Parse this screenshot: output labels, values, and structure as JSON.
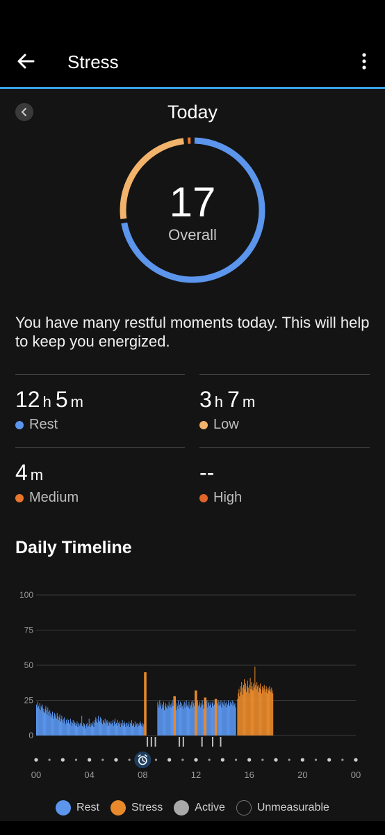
{
  "header": {
    "title": "Stress"
  },
  "overview": {
    "date_label": "Today",
    "score": "17",
    "score_label": "Overall",
    "ring": {
      "rest_fraction": 0.725,
      "low_fraction": 0.259,
      "medium_fraction": 0.016,
      "colors": {
        "rest": "#5b95ec",
        "low": "#f2b36b",
        "medium": "#e8762c"
      }
    }
  },
  "summary_text": "You have many restful moments today. This will help to keep you energized.",
  "stats": [
    {
      "h": "12",
      "h_unit": "h",
      "m": "5",
      "m_unit": "m",
      "label": "Rest",
      "color": "#5b95ec"
    },
    {
      "h": "3",
      "h_unit": "h",
      "m": "7",
      "m_unit": "m",
      "label": "Low",
      "color": "#f2b36b"
    },
    {
      "h": "",
      "h_unit": "",
      "m": "4",
      "m_unit": "m",
      "label": "Medium",
      "color": "#e8762c"
    },
    {
      "h": "",
      "h_unit": "",
      "m": "--",
      "m_unit": "",
      "label": "High",
      "color": "#e0652a"
    }
  ],
  "timeline": {
    "title": "Daily Timeline"
  },
  "chart_data": {
    "type": "bar",
    "title": "Daily Timeline",
    "x_ticks": [
      "00",
      "04",
      "08",
      "12",
      "16",
      "20",
      "00"
    ],
    "y_ticks": [
      0,
      25,
      50,
      75,
      100
    ],
    "ylim": [
      0,
      100
    ],
    "xlim_hours": [
      0,
      24
    ],
    "grid": true,
    "legend_placement": "bottom",
    "series": [
      {
        "name": "Rest",
        "color": "#5b95ec",
        "segments": [
          {
            "start_hour": 0.0,
            "end_hour": 0.6,
            "values": [
              22,
              20,
              24,
              21,
              19,
              23,
              18,
              21,
              20,
              22,
              19,
              17
            ]
          },
          {
            "start_hour": 0.6,
            "end_hour": 1.4,
            "values": [
              16,
              19,
              21,
              18,
              15,
              20,
              17,
              14,
              18,
              16,
              13,
              15,
              17,
              12,
              14,
              16
            ]
          },
          {
            "start_hour": 1.4,
            "end_hour": 2.4,
            "values": [
              15,
              13,
              12,
              16,
              14,
              11,
              13,
              15,
              10,
              12,
              14,
              11,
              9,
              12,
              13,
              10,
              8,
              11,
              12,
              9
            ]
          },
          {
            "start_hour": 2.4,
            "end_hour": 3.3,
            "values": [
              11,
              9,
              8,
              12,
              10,
              7,
              9,
              11,
              8,
              10,
              9,
              7,
              8,
              10,
              6,
              9,
              8,
              7
            ]
          },
          {
            "start_hour": 3.3,
            "end_hour": 4.4,
            "values": [
              9,
              8,
              14,
              7,
              6,
              9,
              8,
              7,
              5,
              8,
              9,
              6,
              7,
              12,
              8,
              6,
              9,
              7,
              8,
              10,
              6,
              9
            ]
          },
          {
            "start_hour": 4.4,
            "end_hour": 5.6,
            "values": [
              11,
              13,
              10,
              12,
              9,
              14,
              11,
              10,
              13,
              9,
              12,
              8,
              11,
              10,
              9,
              12,
              8,
              10,
              11,
              9,
              7,
              10,
              9,
              8
            ]
          },
          {
            "start_hour": 5.6,
            "end_hour": 6.8,
            "values": [
              10,
              8,
              9,
              11,
              7,
              10,
              12,
              8,
              9,
              7,
              11,
              9,
              8,
              10,
              6,
              9,
              8,
              11,
              7,
              9,
              10,
              8,
              6,
              9
            ]
          },
          {
            "start_hour": 6.8,
            "end_hour": 8.1,
            "values": [
              9,
              7,
              8,
              10,
              6,
              9,
              8,
              11,
              7,
              9,
              8,
              6,
              10,
              7,
              8,
              9,
              6,
              8,
              7,
              9,
              10,
              8,
              7,
              9,
              6,
              8
            ]
          },
          {
            "start_hour": 9.1,
            "end_hour": 10.1,
            "values": [
              24,
              22,
              20,
              25,
              21,
              23,
              19,
              22,
              20,
              24,
              18,
              21,
              23,
              20,
              22,
              19,
              21,
              24,
              20,
              22
            ]
          },
          {
            "start_hour": 10.1,
            "end_hour": 11.6,
            "values": [
              20,
              23,
              25,
              21,
              19,
              24,
              22,
              20,
              18,
              23,
              21,
              25,
              19,
              22,
              24,
              20,
              23,
              21,
              19,
              22,
              24,
              20,
              23,
              25,
              21,
              22,
              20,
              24,
              19,
              21
            ]
          },
          {
            "start_hour": 11.6,
            "end_hour": 13.6,
            "values": [
              22,
              24,
              20,
              25,
              23,
              21,
              24,
              22,
              19,
              23,
              25,
              21,
              22,
              24,
              20,
              23,
              21,
              25,
              22,
              19,
              24,
              23,
              21,
              22,
              25,
              20,
              23,
              24,
              21,
              22,
              24,
              20,
              23,
              25,
              21,
              22,
              24,
              23,
              20,
              22
            ]
          },
          {
            "start_hour": 13.6,
            "end_hour": 15.0,
            "values": [
              23,
              25,
              21,
              24,
              22,
              25,
              20,
              23,
              24,
              22,
              25,
              21,
              23,
              24,
              20,
              22,
              25,
              23,
              21,
              24,
              22,
              23,
              25,
              21,
              24,
              22,
              23,
              20
            ]
          }
        ]
      },
      {
        "name": "Stress",
        "color": "#e8892c",
        "segments": [
          {
            "start_hour": 8.1,
            "end_hour": 8.3,
            "values": [
              45
            ]
          },
          {
            "start_hour": 10.3,
            "end_hour": 10.5,
            "values": [
              28
            ]
          },
          {
            "start_hour": 11.9,
            "end_hour": 12.1,
            "values": [
              32
            ]
          },
          {
            "start_hour": 12.6,
            "end_hour": 12.8,
            "values": [
              27
            ]
          },
          {
            "start_hour": 13.4,
            "end_hour": 13.6,
            "values": [
              26
            ]
          },
          {
            "start_hour": 15.1,
            "end_hour": 17.8,
            "values": [
              26,
              30,
              33,
              28,
              35,
              31,
              38,
              34,
              29,
              36,
              40,
              33,
              37,
              31,
              35,
              39,
              34,
              30,
              36,
              41,
              33,
              38,
              35,
              32,
              37,
              34,
              49,
              36,
              33,
              38,
              35,
              31,
              36,
              34,
              37,
              33,
              30,
              35,
              32,
              34,
              36,
              33,
              31,
              35,
              33,
              30,
              34,
              32,
              35,
              33,
              31,
              34,
              32,
              30
            ]
          }
        ]
      }
    ],
    "active_markers_hours": [
      8.3,
      8.6,
      8.9,
      10.7,
      11.0,
      12.4,
      13.2,
      13.8
    ]
  },
  "legend": [
    {
      "label": "Rest",
      "color": "#5b95ec",
      "style": "filled"
    },
    {
      "label": "Stress",
      "color": "#e8892c",
      "style": "filled"
    },
    {
      "label": "Active",
      "color": "#a9a9a9",
      "style": "filled"
    },
    {
      "label": "Unmeasurable",
      "color": "#777777",
      "style": "outline"
    }
  ]
}
